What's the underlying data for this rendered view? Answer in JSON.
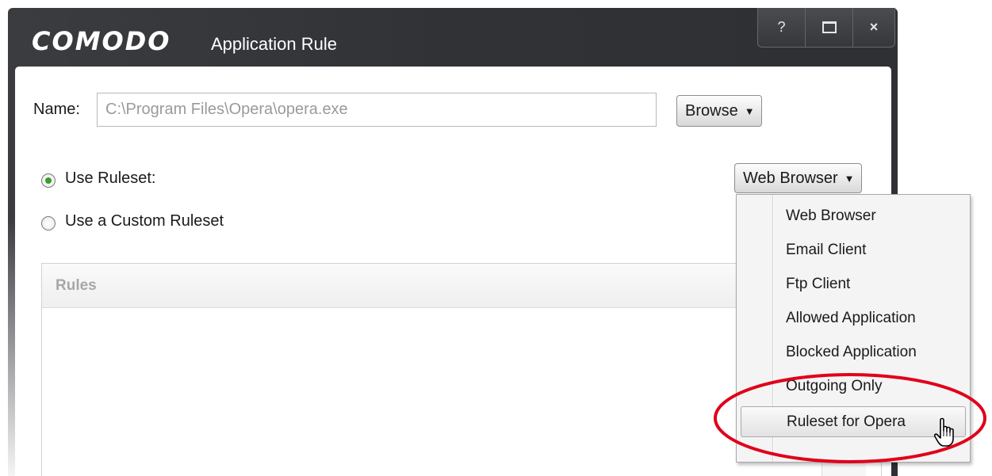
{
  "window": {
    "logo": "COMODO",
    "title": "Application Rule",
    "controls": {
      "help": "?",
      "close": "×"
    }
  },
  "form": {
    "name_label": "Name:",
    "name_value": "C:\\Program Files\\Opera\\opera.exe",
    "browse_label": "Browse",
    "use_ruleset_label": "Use Ruleset:",
    "use_custom_label": "Use a Custom Ruleset",
    "ruleset_selected": "Web Browser",
    "use_ruleset_checked": true
  },
  "rules_panel": {
    "header": "Rules"
  },
  "ruleset_menu": {
    "items": [
      "Web Browser",
      "Email Client",
      "Ftp Client",
      "Allowed Application",
      "Blocked Application",
      "Outgoing Only",
      "Ruleset for Opera"
    ],
    "highlighted": "Ruleset for Opera"
  },
  "colors": {
    "frame": "#303236",
    "radio_checked": "#3b9b2b",
    "highlight_ellipse": "#e0001a"
  },
  "icons": [
    "help-icon",
    "maximize-icon",
    "close-icon",
    "dropdown-caret-icon",
    "hand-cursor-icon"
  ]
}
